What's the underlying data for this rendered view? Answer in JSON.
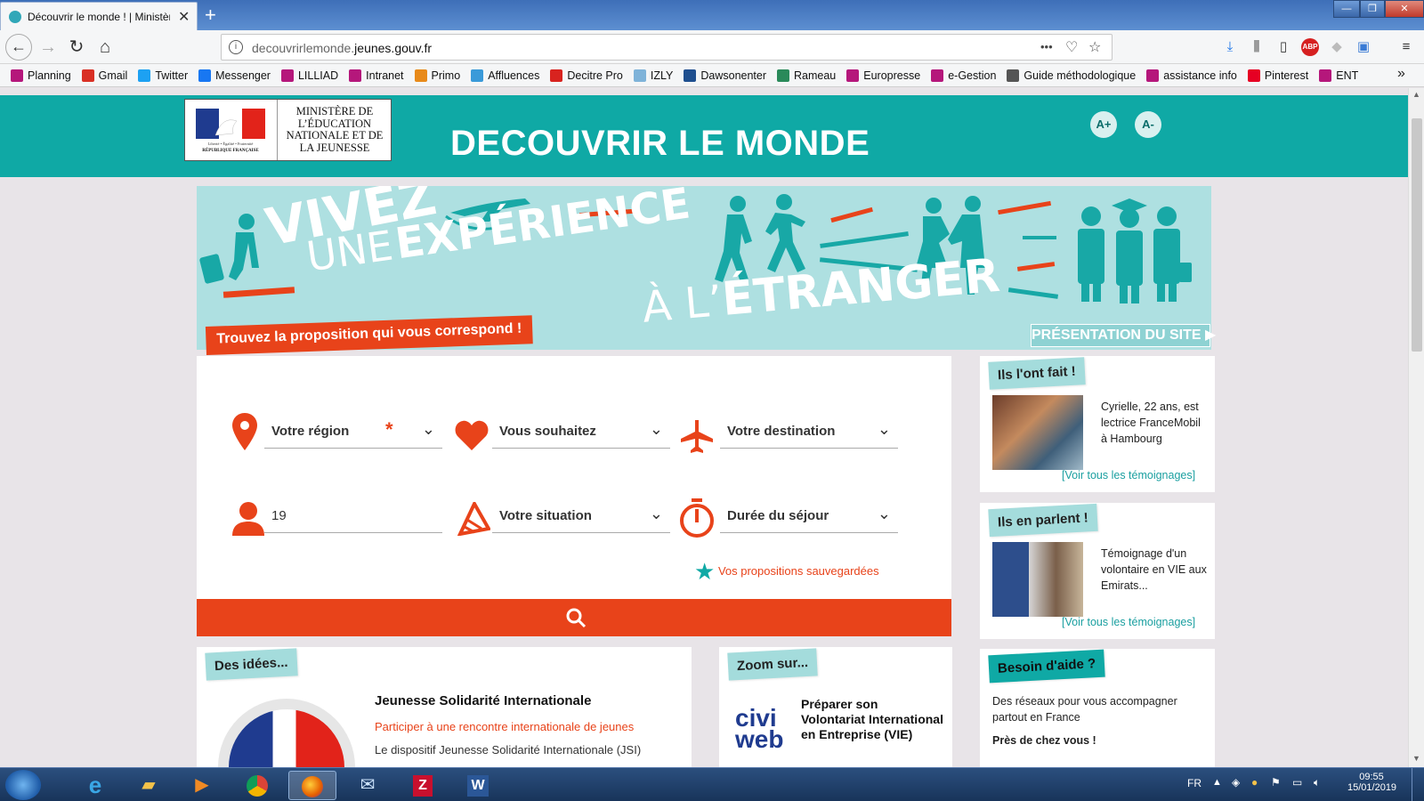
{
  "browser": {
    "tab_title": "Découvrir le monde ! | Ministère",
    "tab_close": "✕",
    "new_tab": "+",
    "url_domain_pre": "decouvrirlemonde.",
    "url_domain_main": "jeunes.gouv.fr",
    "url_more": "•••",
    "window_buttons": [
      "—",
      "❐",
      "✕"
    ],
    "bookmarks": [
      {
        "label": "Planning",
        "icon": "u-icon",
        "color": "#b5177b"
      },
      {
        "label": "Gmail",
        "icon": "gmail-icon",
        "color": "#d93025"
      },
      {
        "label": "Twitter",
        "icon": "twitter-icon",
        "color": "#1da1f2"
      },
      {
        "label": "Messenger",
        "icon": "messenger-icon",
        "color": "#1877f2"
      },
      {
        "label": "LILLIAD",
        "icon": "u-icon",
        "color": "#b5177b"
      },
      {
        "label": "Intranet",
        "icon": "u-icon",
        "color": "#b5177b"
      },
      {
        "label": "Primo",
        "icon": "primo-icon",
        "color": "#e88a1a"
      },
      {
        "label": "Affluences",
        "icon": "affluences-icon",
        "color": "#3a9ad9"
      },
      {
        "label": "Decitre Pro",
        "icon": "decitre-icon",
        "color": "#d8231f"
      },
      {
        "label": "IZLY",
        "icon": "izly-icon",
        "color": "#7fb3d9"
      },
      {
        "label": "Dawsonenter",
        "icon": "dawson-icon",
        "color": "#1f4f8f"
      },
      {
        "label": "Rameau",
        "icon": "rameau-icon",
        "color": "#2a8a5a"
      },
      {
        "label": "Europresse",
        "icon": "u-icon",
        "color": "#b5177b"
      },
      {
        "label": "e-Gestion",
        "icon": "u-icon",
        "color": "#b5177b"
      },
      {
        "label": "Guide méthodologique",
        "icon": "globe-icon",
        "color": "#555555"
      },
      {
        "label": "assistance info",
        "icon": "u-icon",
        "color": "#b5177b"
      },
      {
        "label": "Pinterest",
        "icon": "pinterest-icon",
        "color": "#e60023"
      },
      {
        "label": "ENT",
        "icon": "u-icon",
        "color": "#b5177b"
      }
    ],
    "bookmarks_more": "»"
  },
  "header": {
    "ministry": "MINISTÈRE DE L’ÉDUCATION NATIONALE ET DE LA JEUNESSE",
    "flag_motto": "Liberté • Égalité • Fraternité",
    "flag_label": "RÉPUBLIQUE FRANÇAISE",
    "site_title": "DECOUVRIR LE MONDE",
    "font_plus": "A+",
    "font_minus": "A-"
  },
  "banner": {
    "line1": "VIVEZ",
    "line2a": "UNE",
    "line2b": "EXPÉRIENCE",
    "line3a": "À L’",
    "line3b": "ÉTRANGER",
    "cta": "Trouvez la proposition qui vous correspond !",
    "presentation": "PRÉSENTATION DU SITE"
  },
  "search": {
    "region": "Votre région",
    "required_mark": "*",
    "wish": "Vous souhaitez",
    "destination": "Votre destination",
    "age": "19",
    "situation": "Votre situation",
    "duration": "Durée du séjour",
    "saved": "Vos propositions sauvegardées"
  },
  "sidebar": {
    "did_it": {
      "tag": "Ils l'ont fait !",
      "text": "Cyrielle, 22 ans, est lectrice FranceMobil à Hambourg",
      "link": "[Voir tous les témoignages]"
    },
    "talk": {
      "tag": "Ils en parlent !",
      "text": "Témoignage d'un volontaire en VIE aux Emirats...",
      "link": "[Voir tous les témoignages]"
    },
    "help": {
      "tag": "Besoin d'aide ?",
      "text": "Des réseaux pour vous accompagner partout en France",
      "bold": "Près de chez vous !"
    }
  },
  "ideas": {
    "tag": "Des idées...",
    "title": "Jeunesse Solidarité Internationale",
    "subtitle": "Participer à une rencontre internationale de jeunes",
    "body": "Le dispositif Jeunesse Solidarité Internationale (JSI)"
  },
  "zoom": {
    "tag": "Zoom sur...",
    "logo_a": "civi",
    "logo_b": "web",
    "title": "Préparer son Volontariat International en Entreprise (VIE)"
  },
  "taskbar": {
    "lang": "FR",
    "time": "09:55",
    "date": "15/01/2019"
  },
  "colors": {
    "teal": "#0fa9a5",
    "orange": "#e8431a",
    "light_teal": "#aee0e1"
  }
}
